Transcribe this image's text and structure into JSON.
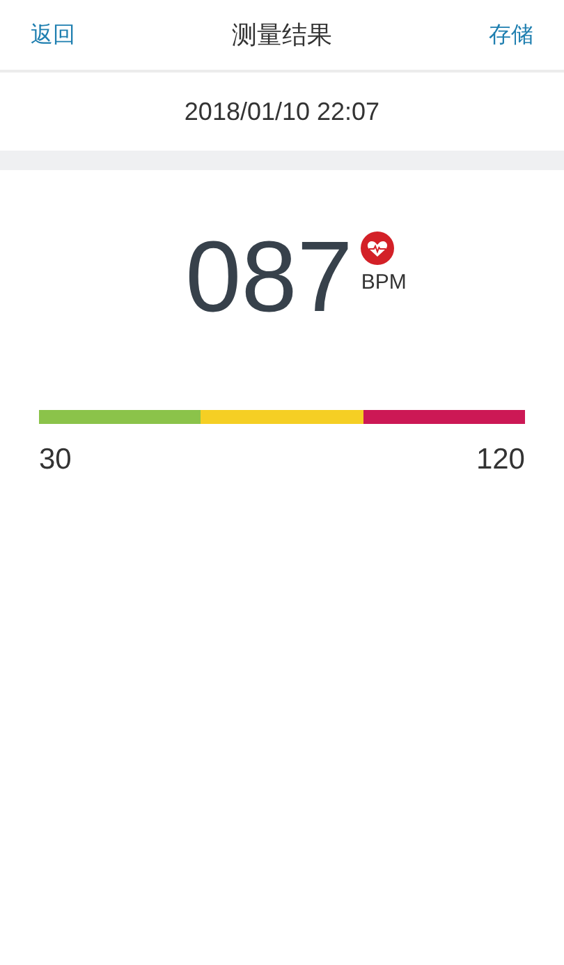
{
  "header": {
    "back": "返回",
    "title": "测量结果",
    "save": "存储"
  },
  "timestamp": "2018/01/10 22:07",
  "reading": {
    "value": "087",
    "unit": "BPM"
  },
  "scale": {
    "segments": [
      {
        "color": "#8bc34a"
      },
      {
        "color": "#f5cf24"
      },
      {
        "color": "#cc1855"
      }
    ],
    "min": "30",
    "max": "120"
  }
}
